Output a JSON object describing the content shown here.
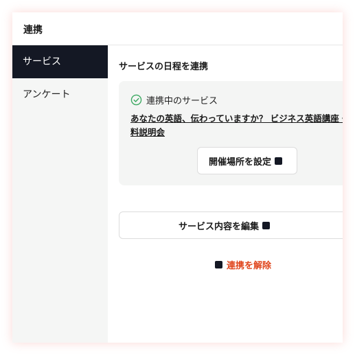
{
  "panel": {
    "title": "連携"
  },
  "sidebar": {
    "items": [
      {
        "label": "サービス",
        "active": true
      },
      {
        "label": "アンケート",
        "active": false
      }
    ]
  },
  "main": {
    "section_title": "サービスの日程を連携",
    "linked": {
      "status_icon": "check-circle-icon",
      "status_label": "連携中のサービス",
      "service_title": "あなたの英語、伝わっていますか？ ビジネス英語講座・無料説明会",
      "location_button_label": "開催場所を設定"
    },
    "edit_button_label": "サービス内容を編集",
    "unlink_button_label": "連携を解除"
  },
  "colors": {
    "active_sidebar": "#141824",
    "check_green": "#3aa860",
    "danger": "#e0451c"
  }
}
